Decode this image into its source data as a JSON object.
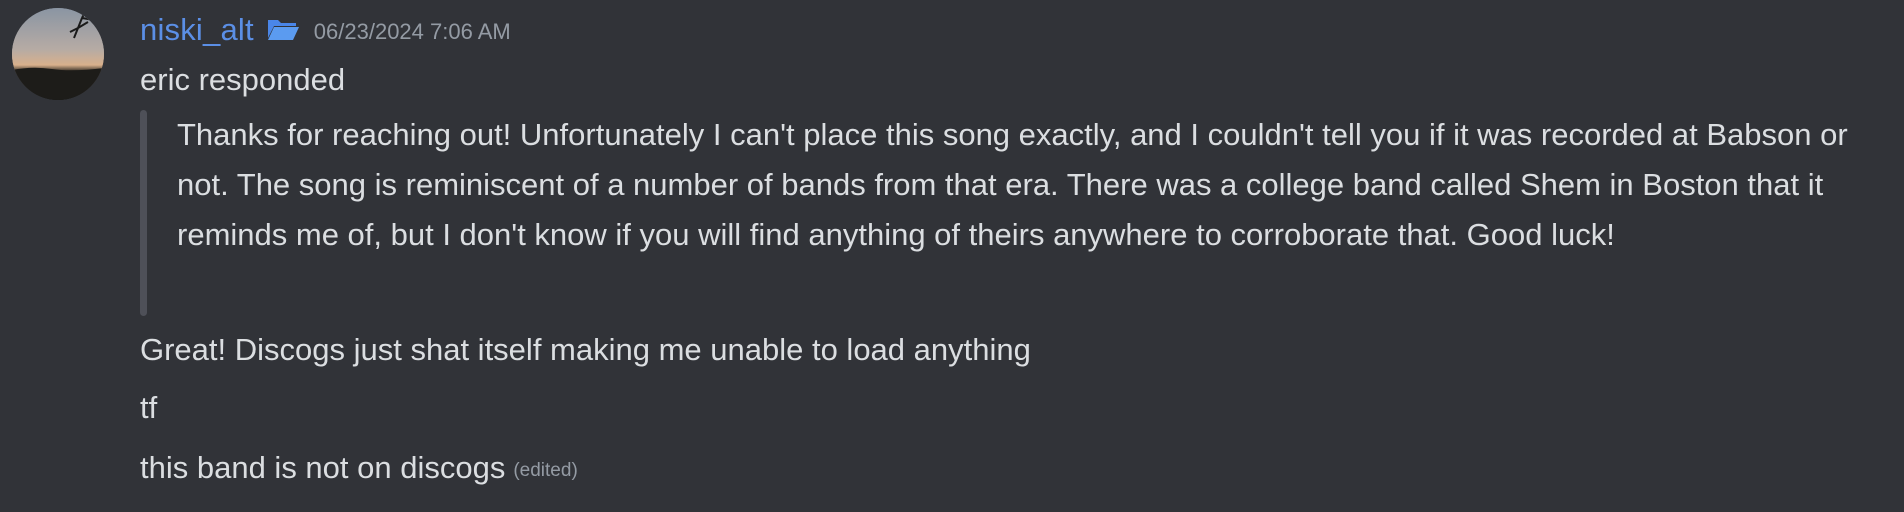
{
  "message": {
    "author": "niski_alt",
    "timestamp": "06/23/2024 7:06 AM",
    "author_color": "#5b8fe6",
    "badge_icon": "folder-icon",
    "avatar_icon": "sunset-landscape-avatar"
  },
  "lines": {
    "intro": "eric responded",
    "quote": "Thanks for reaching out! Unfortunately I can't place this song exactly, and I couldn't tell you if it was recorded at Babson or not. The song is reminiscent of a number of bands from that era. There was a college band called Shem in Boston that it reminds me of, but I don't know if you will find anything of theirs anywhere to corroborate that. Good luck!",
    "line2": "Great! Discogs just shat itself making me unable to load anything",
    "line3": "tf",
    "line4": "this band is not on discogs",
    "edited_label": "(edited)"
  }
}
